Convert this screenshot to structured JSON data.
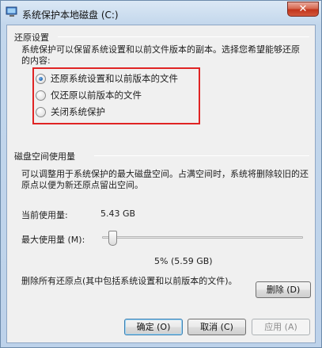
{
  "window": {
    "title": "系统保护本地磁盘 (C:)",
    "close_label": "✕"
  },
  "restore_settings": {
    "heading": "还原设置",
    "description": "系统保护可以保留系统设置和以前文件版本的副本。选择您希望能够还原的内容:",
    "options": [
      {
        "label": "还原系统设置和以前版本的文件",
        "checked": true
      },
      {
        "label": "仅还原以前版本的文件",
        "checked": false
      },
      {
        "label": "关闭系统保护",
        "checked": false
      }
    ]
  },
  "disk_usage": {
    "heading": "磁盘空间使用量",
    "description": "可以调整用于系统保护的最大磁盘空间。占满空间时，系统将删除较旧的还原点以便为新还原点留出空间。",
    "current_label": "当前使用量:",
    "current_value": "5.43 GB",
    "max_label": "最大使用量 (M):",
    "max_value": "5% (5.59 GB)",
    "slider_percent": 5
  },
  "delete_section": {
    "description": "删除所有还原点(其中包括系统设置和以前版本的文件)。",
    "delete_button": "删除 (D)"
  },
  "footer": {
    "ok": "确定 (O)",
    "cancel": "取消 (C)",
    "apply": "应用 (A)"
  },
  "colors": {
    "highlight_box": "#e02424",
    "window_frame": "#c3d7ec",
    "panel": "#f0f0f0"
  }
}
